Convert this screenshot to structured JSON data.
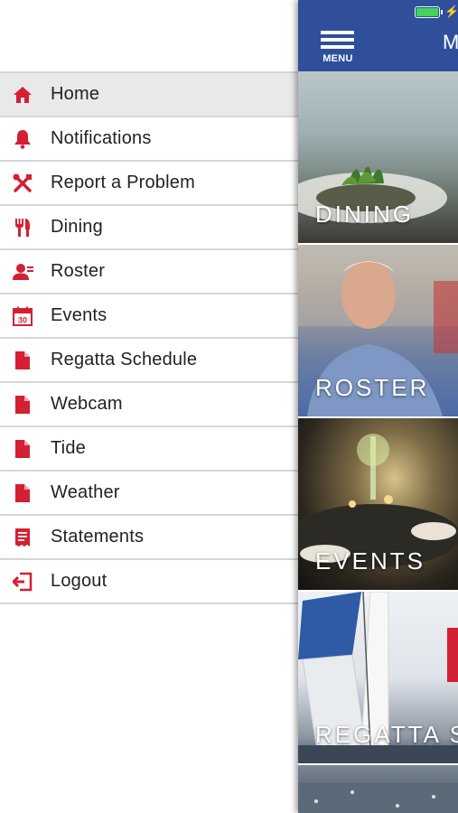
{
  "drawer": {
    "items": [
      {
        "label": "Home",
        "icon": "home-icon",
        "active": true
      },
      {
        "label": "Notifications",
        "icon": "bell-icon"
      },
      {
        "label": "Report a Problem",
        "icon": "tools-icon"
      },
      {
        "label": "Dining",
        "icon": "cutlery-icon"
      },
      {
        "label": "Roster",
        "icon": "user-icon"
      },
      {
        "label": "Events",
        "icon": "calendar-icon"
      },
      {
        "label": "Regatta Schedule",
        "icon": "document-icon"
      },
      {
        "label": "Webcam",
        "icon": "document-icon"
      },
      {
        "label": "Tide",
        "icon": "document-icon"
      },
      {
        "label": "Weather",
        "icon": "document-icon"
      },
      {
        "label": "Statements",
        "icon": "statement-icon"
      },
      {
        "label": "Logout",
        "icon": "logout-icon"
      }
    ],
    "calendar_day": "30"
  },
  "topbar": {
    "menu_label": "MENU",
    "title_peek": "M"
  },
  "tiles": [
    {
      "label": "DINING"
    },
    {
      "label": "ROSTER"
    },
    {
      "label": "EVENTS"
    },
    {
      "label": "REGATTA S"
    }
  ],
  "colors": {
    "accent_red": "#d32034",
    "topbar_blue": "#2f4f9b",
    "active_row": "#e9e9e9"
  }
}
